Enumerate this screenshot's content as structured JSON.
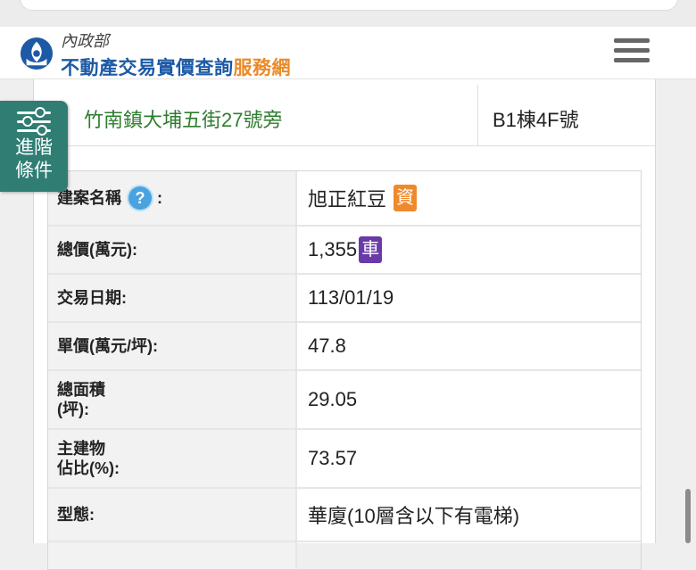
{
  "header": {
    "ministry": "內政部",
    "site_name_main": "不動產交易實價查詢",
    "site_name_accent": "服務網"
  },
  "listing": {
    "address": "竹南鎮大埔五街27號旁",
    "unit": "B1棟4F號"
  },
  "filter_tab": {
    "line1": "進階",
    "line2": "條件"
  },
  "details": {
    "project_name_label": "建案名稱",
    "project_name_suffix": ":",
    "help_glyph": "?",
    "project_name": "旭正紅豆",
    "project_badge": "資",
    "total_price_label": "總價(萬元):",
    "total_price": "1,355",
    "parking_badge": "車",
    "trade_date_label": "交易日期:",
    "trade_date": "113/01/19",
    "unit_price_label": "單價(萬元/坪):",
    "unit_price": "47.8",
    "total_area_label_1": "總面積",
    "total_area_label_2": "(坪):",
    "total_area": "29.05",
    "main_bldg_label_1": "主建物",
    "main_bldg_label_2": "佔比(%):",
    "main_bldg_ratio": "73.57",
    "type_label": "型態:",
    "type_value": "華廈(10層含以下有電梯)"
  },
  "colors": {
    "brand_blue": "#1c5aa6",
    "brand_orange": "#e98b2a",
    "address_green": "#2f7d2f",
    "filter_teal": "#2f7d73",
    "badge_orange": "#ee8a2d",
    "badge_purple": "#6a3aa8",
    "help_blue": "#4aa3df"
  },
  "icons": {
    "logo": "ministry-logo-icon",
    "menu": "hamburger-menu-icon",
    "filter": "sliders-icon",
    "help": "question-circle-icon"
  }
}
